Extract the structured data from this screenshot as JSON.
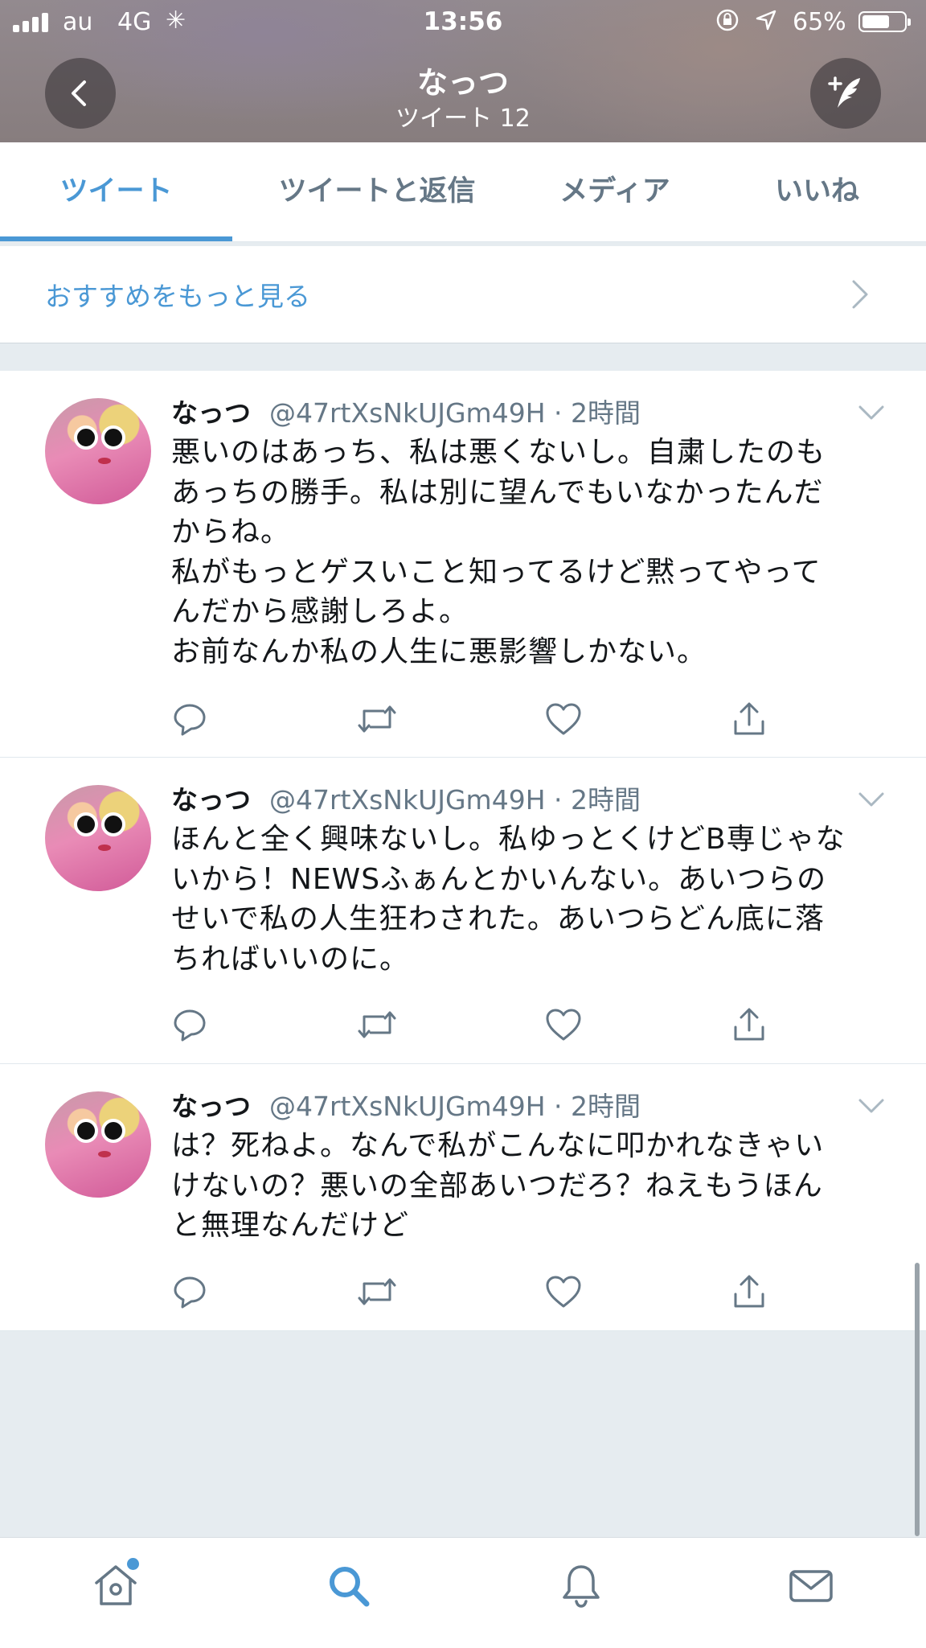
{
  "status_bar": {
    "carrier": "au",
    "network": "4G",
    "time": "13:56",
    "battery_percent": "65%",
    "battery_level": 0.65
  },
  "header": {
    "profile_name": "なっつ",
    "tweet_count": "ツイート 12",
    "back_icon": "chevron-left-icon",
    "compose_icon": "compose-tweet-icon"
  },
  "tabs": [
    {
      "label": "ツイート",
      "active": true
    },
    {
      "label": "ツイートと返信",
      "active": false
    },
    {
      "label": "メディア",
      "active": false
    },
    {
      "label": "いいね",
      "active": false
    }
  ],
  "recommend": {
    "label": "おすすめをもっと見る"
  },
  "tweets": [
    {
      "name": "なっつ",
      "handle": "@47rtXsNkUJGm49H · 2時間",
      "text": "悪いのはあっち、私は悪くないし。自粛したのも\nあっちの勝手。私は別に望んでもいなかったんだ\nからね。\n私がもっとゲスいこと知ってるけど黙ってやって\nんだから感謝しろよ。\nお前なんか私の人生に悪影響しかない。"
    },
    {
      "name": "なっつ",
      "handle": "@47rtXsNkUJGm49H · 2時間",
      "text": "ほんと全く興味ないし。私ゆっとくけどB専じゃな\nいから！NEWSふぁんとかいんない。あいつらの\nせいで私の人生狂わされた。あいつらどん底に落\nちればいいのに。"
    },
    {
      "name": "なっつ",
      "handle": "@47rtXsNkUJGm49H · 2時間",
      "text": "は？死ねよ。なんで私がこんなに叩かれなきゃい\nけないの？悪いの全部あいつだろ？ねえもうほん\nと無理なんだけど"
    }
  ],
  "action_icons": [
    "reply-icon",
    "retweet-icon",
    "like-icon",
    "share-icon"
  ],
  "bottom_tabs": [
    "home-icon",
    "search-icon",
    "notifications-icon",
    "messages-icon"
  ],
  "colors": {
    "accent": "#4a98d5",
    "text_primary": "#14171a",
    "text_secondary": "#657786",
    "background": "#e6ecf0"
  }
}
